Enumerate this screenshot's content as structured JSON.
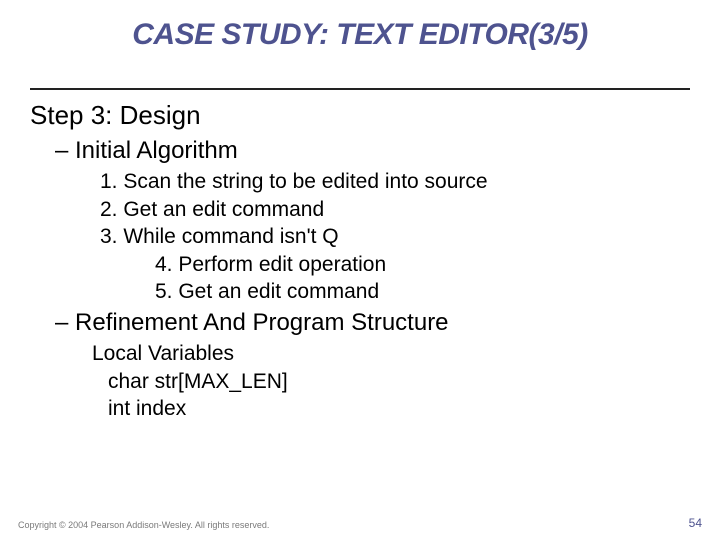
{
  "title": "CASE STUDY: TEXT EDITOR(3/5)",
  "step_heading": "Step 3: Design",
  "sub_initial": "– Initial Algorithm",
  "algo": {
    "l1": "1. Scan the string to be edited into source",
    "l2": "2. Get an edit command",
    "l3": "3. While command isn't Q",
    "l4": "4. Perform edit operation",
    "l5": "5. Get an edit command"
  },
  "sub_refine": "– Refinement And Program Structure",
  "locvar": {
    "h": "Local Variables",
    "v1": "char str[MAX_LEN]",
    "v2": "int index"
  },
  "footer": "Copyright © 2004 Pearson Addison-Wesley. All rights reserved.",
  "pagenum": "54"
}
